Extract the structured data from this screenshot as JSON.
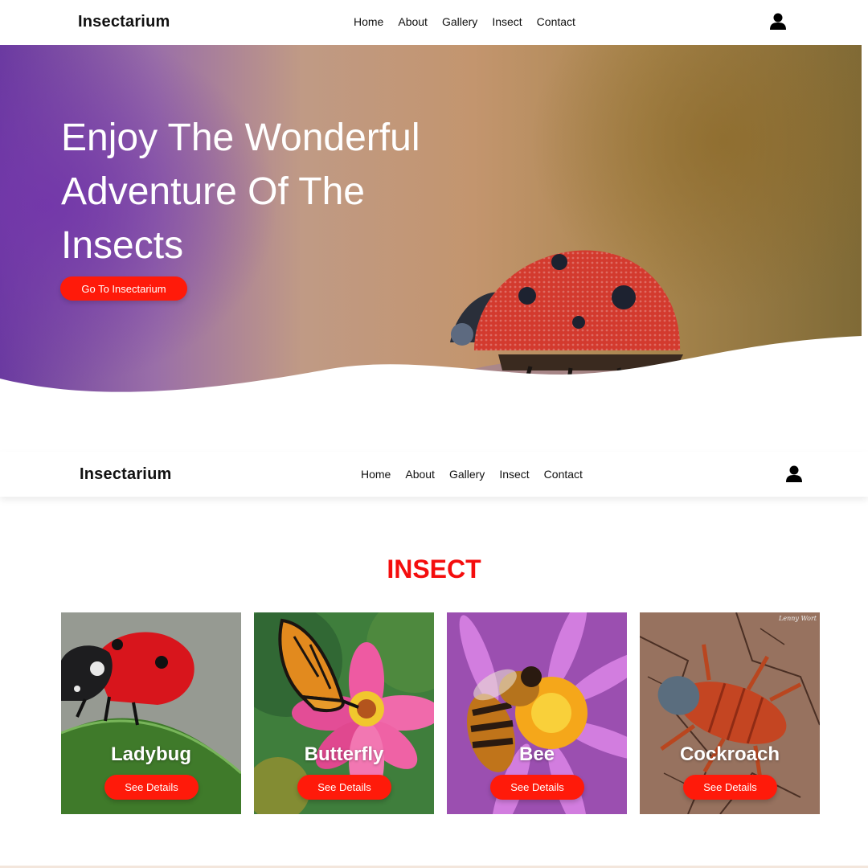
{
  "brand": "Insectarium",
  "nav": {
    "items": [
      "Home",
      "About",
      "Gallery",
      "Insect",
      "Contact"
    ],
    "user_icon": "user-icon"
  },
  "hero": {
    "title": "Enjoy The Wonderful Adventure Of The Insects",
    "button_label": "Go To Insectarium"
  },
  "section": {
    "title": "INSECT"
  },
  "cards": [
    {
      "name": "Ladybug",
      "button_label": "See Details"
    },
    {
      "name": "Butterfly",
      "button_label": "See Details"
    },
    {
      "name": "Bee",
      "button_label": "See Details"
    },
    {
      "name": "Cockroach",
      "button_label": "See Details",
      "watermark": "Lenny Wort"
    }
  ],
  "colors": {
    "accent": "#ff1a0a",
    "section_title": "#f40d0d",
    "text": "#111111"
  }
}
